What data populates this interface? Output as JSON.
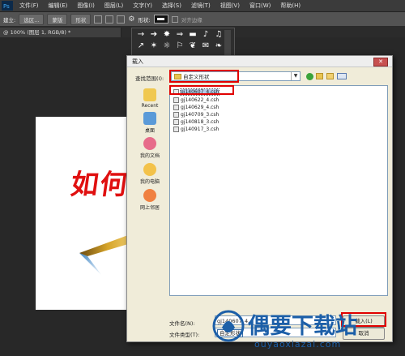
{
  "menubar": {
    "items": [
      "文件(F)",
      "编辑(E)",
      "图像(I)",
      "图层(L)",
      "文字(Y)",
      "选择(S)",
      "滤镜(T)",
      "视图(V)",
      "窗口(W)",
      "帮助(H)"
    ]
  },
  "optbar": {
    "tool_label": "建立:",
    "selection_btn": "选区...",
    "mask_btn": "蒙版",
    "shape_btn": "形状",
    "shape_label": "形状:",
    "align_edges": "对齐边缘"
  },
  "document": {
    "tab": "@ 100% (图层 1, RGB/8) *"
  },
  "canvas_art": {
    "chars": [
      "如",
      "何"
    ]
  },
  "dialog": {
    "title": "载入",
    "close": "✕",
    "lookin_label": "查找范围(I):",
    "lookin_value": "自定义形状",
    "places": [
      {
        "label": "Recent",
        "icon": "recent-folder-icon"
      },
      {
        "label": "桌面",
        "icon": "desktop-icon"
      },
      {
        "label": "我的文档",
        "icon": "my-documents-icon"
      },
      {
        "label": "我的电脑",
        "icon": "my-computer-icon"
      },
      {
        "label": "网上邻居",
        "icon": "network-places-icon"
      }
    ],
    "files": [
      "gj140607_4.csh",
      "gj140622_4.csh",
      "gj140629_4.csh",
      "gj140709_3.csh",
      "gj140818_3.csh",
      "gj140917_3.csh"
    ],
    "selected_file": "gj140607_4.csh",
    "filename_label": "文件名(N):",
    "filename_value": "gj140607_4...",
    "filetype_label": "文件类型(T):",
    "filetype_value": "自定形状",
    "load_btn": "载入(L)",
    "cancel_btn": "取消"
  },
  "watermark": {
    "brand": "偶要下载站",
    "url": "ouyaoxiazai.com"
  },
  "colors": {
    "red": "#e00000",
    "dialog_bg": "#f0ecd9",
    "watermark": "#1c5fa8"
  }
}
